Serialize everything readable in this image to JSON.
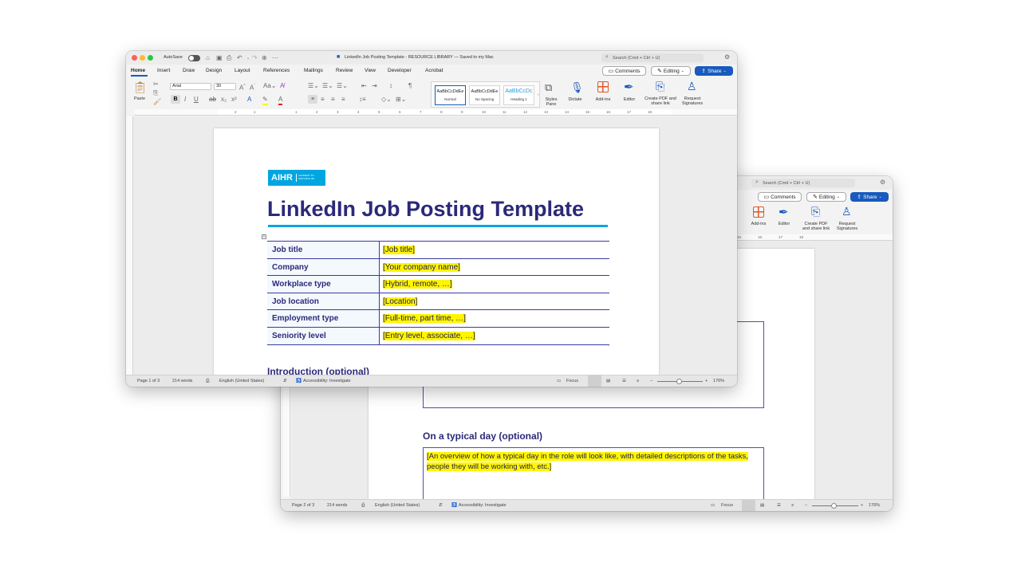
{
  "back_window": {
    "search_placeholder": "Search (Cmd + Ctrl + U)",
    "comments_label": "Comments",
    "editing_label": "Editing",
    "share_label": "Share",
    "addins_label": "Add-ins",
    "editor_label": "Editor",
    "create_pdf_label": "Create PDF and share link",
    "request_sig_label": "Request Signatures",
    "ruler_labels": [
      "15",
      "16",
      "17",
      "18"
    ],
    "section_heading": "On a typical day (optional)",
    "typical_day_text": "[An overview of how a typical day in the role will look like, with detailed descriptions of the tasks, people they will be working with, etc.]",
    "status": {
      "page": "Page 2 of 3",
      "words": "214 words",
      "language": "English (United States)",
      "accessibility": "Accessibility: Investigate",
      "focus": "Focus",
      "zoom": "176%"
    }
  },
  "front_window": {
    "autosave_label": "AutoSave",
    "doc_title": "LinkedIn Job Posting Template - RESOURCE LIBRARY — Saved to my Mac",
    "search_placeholder": "Search (Cmd + Ctrl + U)",
    "tabs": [
      "Home",
      "Insert",
      "Draw",
      "Design",
      "Layout",
      "References",
      "Mailings",
      "Review",
      "View",
      "Developer",
      "Acrobat"
    ],
    "comments_label": "Comments",
    "editing_label": "Editing",
    "share_label": "Share",
    "paste_label": "Paste",
    "font_name": "Arial",
    "font_size": "30",
    "styles": [
      {
        "preview": "AaBbCcDdEe",
        "name": "Normal"
      },
      {
        "preview": "AaBbCcDdEe",
        "name": "No Spacing"
      },
      {
        "preview": "AaBbCcDc",
        "name": "Heading 1"
      }
    ],
    "styles_pane_label": "Styles Pane",
    "dictate_label": "Dictate",
    "addins_label": "Add-ins",
    "editor_label": "Editor",
    "create_pdf_label": "Create PDF and share link",
    "request_sig_label": "Request Signatures",
    "ruler_labels": [
      "2",
      "1",
      "1",
      "2",
      "3",
      "4",
      "5",
      "6",
      "7",
      "8",
      "9",
      "10",
      "11",
      "12",
      "13",
      "14",
      "15",
      "16",
      "17",
      "18"
    ],
    "logo_text": "AIHR",
    "logo_tagline": "ACADEMY TO INNOVATE HR",
    "document_title": "LinkedIn Job Posting Template",
    "table": [
      {
        "label": "Job title",
        "value": "[Job title]"
      },
      {
        "label": "Company",
        "value": "[Your company name]"
      },
      {
        "label": "Workplace type",
        "value": "[Hybrid, remote, …]"
      },
      {
        "label": "Job location",
        "value": "[Location]"
      },
      {
        "label": "Employment type",
        "value": "[Full-time, part time, …]"
      },
      {
        "label": "Seniority level",
        "value": "[Entry level, associate, …]"
      }
    ],
    "intro_heading": "Introduction (optional)",
    "status": {
      "page": "Page 1 of 3",
      "words": "214 words",
      "language": "English (United States)",
      "accessibility": "Accessibility: Investigate",
      "focus": "Focus",
      "zoom": "176%"
    }
  },
  "colors": {
    "title": "#2b2979",
    "accent_line": "#00a6e0",
    "highlight": "#fff500",
    "share": "#185abd",
    "table_border": "#3a3aa0"
  }
}
